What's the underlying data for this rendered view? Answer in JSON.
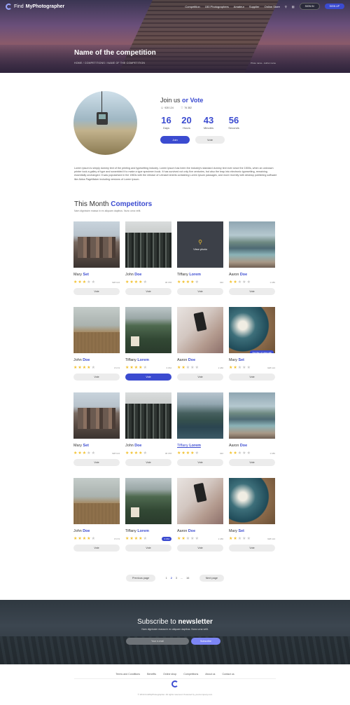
{
  "nav": {
    "logo_left": "Find",
    "logo_right": "MyPhotographer",
    "items": [
      "Competition",
      "150 Photographers",
      "Amateur",
      "Supplier",
      "Online Store"
    ],
    "sign_in": "SIGN IN",
    "sign_up": "SIGN UP"
  },
  "hero": {
    "title": "Name of the competition",
    "breadcrumb": "HOME / COMPETITIONS / NAME OF THE COMPETITION",
    "credit": "Photo name - Author name"
  },
  "competition": {
    "join_prefix": "Join us ",
    "join_accent": "or Vote",
    "participants": "928 124",
    "votes": "76 382",
    "countdown": [
      {
        "num": "16",
        "label": "Days"
      },
      {
        "num": "20",
        "label": "Hours"
      },
      {
        "num": "43",
        "label": "Minutes"
      },
      {
        "num": "56",
        "label": "Seconds"
      }
    ],
    "join_label": "Join",
    "vote_label": "Vote"
  },
  "description": "Lorem Ipsum is simply dummy text of the printing and typesetting industry. Lorem Ipsum has been the industry's standard dummy text ever since the 1500s, when an unknown printer took a galley of type and scrambled it to make a type specimen book. It has survived not only five centuries, but also the leap into electronic typesetting, remaining essentially unchanged. It was popularised in the 1960s with the release of Letraset sheets containing Lorem Ipsum passages, and more recently with desktop publishing software like Aldus PageMaker including versions of Lorem Ipsum.",
  "competitors": {
    "title_prefix": "This Month ",
    "title_accent": "Competitors",
    "subtitle": "Nam dignissim massa in ex aliquam dapibus. Nunc urna velit.",
    "view_photo": "View photo",
    "badge_text": "Number of votes ask",
    "items": [
      {
        "first": "Mary",
        "last": "Set",
        "stars": 3,
        "votes": "928 124",
        "vote_label": "Vote"
      },
      {
        "first": "John",
        "last": "Doe",
        "stars": 4,
        "votes": "36 378",
        "vote_label": "Vote"
      },
      {
        "first": "Tiffany",
        "last": "Lorem",
        "stars": 4,
        "votes": "322",
        "vote_label": "Vote"
      },
      {
        "first": "Aaron",
        "last": "Doe",
        "stars": 2,
        "votes": "1 180",
        "vote_label": "Vote"
      },
      {
        "first": "John",
        "last": "Doe",
        "stars": 4,
        "votes": "8 174",
        "vote_label": "Vote"
      },
      {
        "first": "Tiffany",
        "last": "Lorem",
        "stars": 4,
        "votes": "3 152",
        "vote_label": "Vote"
      },
      {
        "first": "Aaron",
        "last": "Doe",
        "stars": 2,
        "votes": "1 180",
        "vote_label": "Vote"
      },
      {
        "first": "Mary",
        "last": "Set",
        "stars": 2,
        "votes": "928 124",
        "vote_label": "Vote"
      },
      {
        "first": "Mary",
        "last": "Set",
        "stars": 3,
        "votes": "928 124",
        "vote_label": "Vote"
      },
      {
        "first": "John",
        "last": "Doe",
        "stars": 4,
        "votes": "36 378",
        "vote_label": "Vote"
      },
      {
        "first": "Tiffany",
        "last": "Lorem",
        "stars": 4,
        "votes": "322",
        "vote_label": "Vote"
      },
      {
        "first": "Aaron",
        "last": "Doe",
        "stars": 2,
        "votes": "1 180",
        "vote_label": "Vote"
      },
      {
        "first": "John",
        "last": "Doe",
        "stars": 4,
        "votes": "8 174",
        "vote_label": "Vote"
      },
      {
        "first": "Tiffany",
        "last": "Lorem",
        "stars": 4,
        "votes": "3 152",
        "vote_label": "Vote"
      },
      {
        "first": "Aaron",
        "last": "Doe",
        "stars": 2,
        "votes": "1 180",
        "vote_label": "Vote"
      },
      {
        "first": "Mary",
        "last": "Set",
        "stars": 2,
        "votes": "928 124",
        "vote_label": "Vote"
      }
    ]
  },
  "pagination": {
    "prev": "Previous page",
    "pages": [
      "1",
      "2",
      "3",
      "...",
      "16"
    ],
    "next": "Next page"
  },
  "newsletter": {
    "title_prefix": "Subscribe to ",
    "title_accent": "newsletter",
    "subtitle": "Nam dignissim massa in ex aliquam dapibus. Nunc urna velit.",
    "email_placeholder": "Your e-mail",
    "button": "Subscribe"
  },
  "footer": {
    "links": [
      "Terms and Conditions",
      "Benefits",
      "Online shop",
      "Competitions",
      "About us",
      "Contact us"
    ],
    "copyright": "© 2019 FindMyPhotographer. All rights reserved. Powered by yourcompany.com"
  },
  "colors": {
    "accent": "#3b4bd0",
    "star": "#f2c12e"
  }
}
